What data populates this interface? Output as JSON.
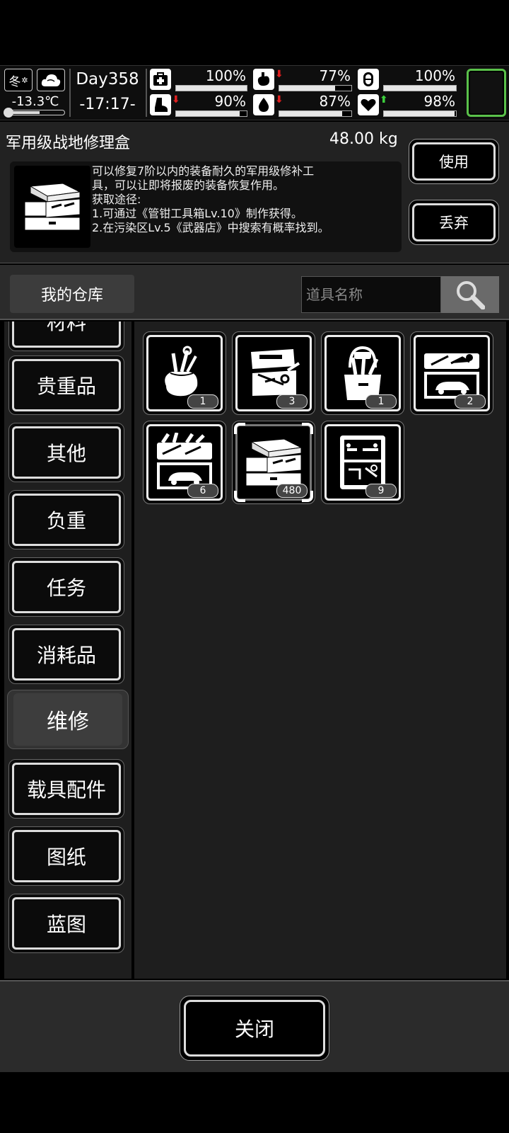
{
  "status": {
    "season": "冬",
    "weather_icon": "cloud-icon",
    "temperature": "-13.3℃",
    "temperature_level": 0.55,
    "day": "Day358",
    "time": "-17:17-",
    "stats": [
      {
        "name": "health",
        "icon": "medkit-icon",
        "value": "100%",
        "level": 1.0,
        "trend": ""
      },
      {
        "name": "hunger",
        "icon": "stomach-icon",
        "value": "77%",
        "level": 0.77,
        "trend": "down"
      },
      {
        "name": "stamina",
        "icon": "pill-icon",
        "value": "100%",
        "level": 1.0,
        "trend": ""
      },
      {
        "name": "endurance",
        "icon": "boot-icon",
        "value": "90%",
        "level": 0.9,
        "trend": "down"
      },
      {
        "name": "thirst",
        "icon": "water-drop-icon",
        "value": "87%",
        "level": 0.87,
        "trend": "down"
      },
      {
        "name": "mood",
        "icon": "heart-icon",
        "value": "98%",
        "level": 0.98,
        "trend": "up"
      }
    ],
    "colors": {
      "down": "#e02020",
      "up": "#3ccf3c",
      "slot_border": "#5ac14a"
    }
  },
  "item": {
    "name": "军用级战地修理盒",
    "weight": "48.00 kg",
    "description": [
      "可以修复7阶以内的装备耐久的军用级修补工",
      "具，可以让即将报废的装备恢复作用。",
      "获取途径:",
      "1.可通过《管钳工具箱Lv.10》制作获得。",
      "2.在污染区Lv.5《武器店》中搜索有概率找到。"
    ],
    "use_label": "使用",
    "drop_label": "丢弃"
  },
  "warehouse": {
    "title": "我的仓库",
    "search_placeholder": "道具名称"
  },
  "categories": [
    {
      "label": "材料",
      "active": false
    },
    {
      "label": "贵重品",
      "active": false
    },
    {
      "label": "其他",
      "active": false
    },
    {
      "label": "负重",
      "active": false
    },
    {
      "label": "任务",
      "active": false
    },
    {
      "label": "消耗品",
      "active": false
    },
    {
      "label": "维修",
      "active": true
    },
    {
      "label": "载具配件",
      "active": false
    },
    {
      "label": "图纸",
      "active": false
    },
    {
      "label": "蓝图",
      "active": false
    }
  ],
  "items": [
    {
      "icon": "tool-bag-icon",
      "count": "1",
      "selected": false
    },
    {
      "icon": "open-toolbox-icon",
      "count": "3",
      "selected": false
    },
    {
      "icon": "tool-bucket-icon",
      "count": "1",
      "selected": false
    },
    {
      "icon": "car-toolbox-icon",
      "count": "2",
      "selected": false
    },
    {
      "icon": "full-car-toolbox-icon",
      "count": "6",
      "selected": false
    },
    {
      "icon": "field-repair-box-icon",
      "count": "480",
      "selected": true
    },
    {
      "icon": "tool-case-icon",
      "count": "9",
      "selected": false
    }
  ],
  "footer": {
    "close_label": "关闭"
  }
}
